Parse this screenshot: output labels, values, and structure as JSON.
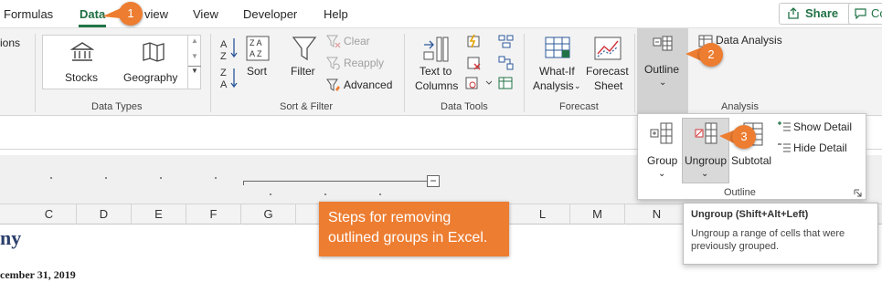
{
  "tabs": {
    "formulas": "Formulas",
    "data": "Data",
    "review": "view",
    "view": "View",
    "developer": "Developer",
    "help": "Help",
    "share": "Share",
    "comments": "Co"
  },
  "ribbon": {
    "left_cut": "ions",
    "data_types": {
      "stocks": "Stocks",
      "geography": "Geography",
      "group": "Data Types"
    },
    "sort_filter": {
      "sort": "Sort",
      "filter": "Filter",
      "clear": "Clear",
      "reapply": "Reapply",
      "advanced": "Advanced",
      "group": "Sort & Filter"
    },
    "data_tools": {
      "text_to_columns_1": "Text to",
      "text_to_columns_2": "Columns",
      "group": "Data Tools"
    },
    "forecast": {
      "whatif_1": "What-If",
      "whatif_2": "Analysis",
      "forecast_1": "Forecast",
      "forecast_2": "Sheet",
      "group": "Forecast"
    },
    "outline": {
      "label": "Outline"
    },
    "analysis": {
      "data_analysis": "Data Analysis",
      "group": "Analysis"
    }
  },
  "dropdown": {
    "group": "Group",
    "ungroup": "Ungroup",
    "subtotal": "Subtotal",
    "show_detail": "Show Detail",
    "hide_detail": "Hide Detail",
    "footer": "Outline"
  },
  "tooltip": {
    "title": "Ungroup (Shift+Alt+Left)",
    "body": "Ungroup a range of cells that were previously grouped."
  },
  "columns": [
    "C",
    "D",
    "E",
    "F",
    "G",
    "H",
    "L",
    "M",
    "N"
  ],
  "cells": {
    "title_fragment": "ny",
    "date_fragment": "cember 31, 2019"
  },
  "callouts": {
    "one": "1",
    "two": "2",
    "three": "3"
  },
  "note": {
    "line1": "Steps for removing",
    "line2": "outlined groups in Excel."
  },
  "colors": {
    "accent": "#217346",
    "callout": "#ed7d31"
  }
}
